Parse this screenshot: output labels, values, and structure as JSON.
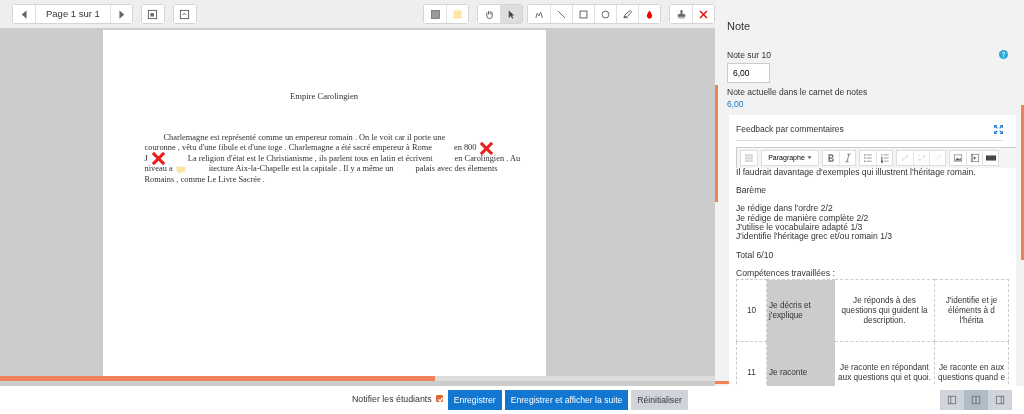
{
  "viewer_toolbar": {
    "page_label": "Page 1 sur 1",
    "nav": [
      {
        "kind": "prev"
      },
      {
        "kind": "label"
      },
      {
        "kind": "next"
      }
    ],
    "view_tools": [
      {
        "kind": "search-comments"
      },
      {
        "kind": "expand"
      }
    ],
    "tool_groups": [
      [
        {
          "kind": "color-gray",
          "selected": false
        },
        {
          "kind": "color-yellow",
          "selected": false
        }
      ],
      [
        {
          "kind": "hand",
          "selected": false
        },
        {
          "kind": "pointer",
          "selected": true
        }
      ],
      [
        {
          "kind": "pen",
          "selected": false
        },
        {
          "kind": "line",
          "selected": false
        },
        {
          "kind": "rectangle",
          "selected": false
        },
        {
          "kind": "oval",
          "selected": false
        },
        {
          "kind": "highlighter",
          "selected": false
        },
        {
          "kind": "drop",
          "selected": false
        }
      ],
      [
        {
          "kind": "stamp",
          "selected": false
        },
        {
          "kind": "cross",
          "selected": false
        }
      ]
    ]
  },
  "document": {
    "title": "Empire Carolingien",
    "lines": [
      {
        "indent": true,
        "segments": [
          {
            "text": "Charlemagne est représenté comme un empereur romain . On le voit car il porte une"
          }
        ]
      },
      {
        "indent": false,
        "segments": [
          {
            "text": "couronne , vêtu d'une fibule et d'une toge . Charlemagne a été sacré empereur à Rome"
          },
          {
            "text": "en 800"
          },
          {
            "kind": "cross"
          }
        ]
      },
      {
        "indent": false,
        "segments": [
          {
            "text": "J"
          },
          {
            "kind": "cross"
          },
          {
            "text": "La religion d'état est le Christianisme , ils parlent tous en latin et écrivent"
          },
          {
            "text": "en Carolingien . Au"
          }
        ]
      },
      {
        "indent": false,
        "segments": [
          {
            "text": "niveau a"
          },
          {
            "kind": "comment"
          },
          {
            "text": "itecture Aix-la-Chapelle est la capitale . Il y a même un"
          },
          {
            "text": "palais avec des élements"
          }
        ]
      },
      {
        "indent": false,
        "segments": [
          {
            "text": "Romains , comme Le Livre Sacrée ."
          }
        ]
      }
    ]
  },
  "grade": {
    "heading": "Note",
    "label": "Note sur 10",
    "value": "6,00",
    "current_label": "Note actuelle dans le carnet de notes",
    "current_value": "6,00"
  },
  "feedback": {
    "title": "Feedback par commentaires",
    "editor_toolbar": [
      [
        {
          "kind": "toggle"
        }
      ],
      [
        {
          "kind": "format",
          "text": "Paragraphe"
        }
      ],
      [
        {
          "kind": "bold"
        },
        {
          "kind": "italic"
        }
      ],
      [
        {
          "kind": "bullets"
        },
        {
          "kind": "numbers"
        }
      ],
      [
        {
          "kind": "link"
        },
        {
          "kind": "unlink"
        },
        {
          "kind": "link-disabled"
        }
      ],
      [
        {
          "kind": "image"
        },
        {
          "kind": "media"
        },
        {
          "kind": "keyboard"
        }
      ]
    ],
    "paragraphs": [
      [
        "Il faudrait davantage d'exemples qui illustrent l'héritage romain."
      ],
      [
        "Barème"
      ],
      [
        "Je rédige dans l'ordre 2/2",
        "Je rédige de manière complète 2/2",
        "J'utilise le vocabulaire adapté 1/3",
        "J'identifie l'héritage grec et/ou romain 1/3"
      ],
      [
        "Total 6/10"
      ],
      [
        "Compétences travaillées :"
      ]
    ],
    "table": {
      "rows": [
        [
          "10",
          "Je décris et j'explique",
          "Je réponds à des questions qui guident la description.",
          "J'identifie et je éléments à d l'hérita"
        ],
        [
          "11",
          "Je raconte",
          "Je raconte en répondant aux questions qui et quoi.",
          "Je raconte en aux questions quand e"
        ]
      ]
    }
  },
  "footer": {
    "notify": {
      "label": "Notifier les étudiants",
      "checked": true
    },
    "buttons": [
      {
        "text": "Enregistrer",
        "kind": "primary"
      },
      {
        "text": "Enregistrer et afficher la suite",
        "kind": "primary"
      },
      {
        "text": "Réinitialiser",
        "kind": "secondary"
      }
    ],
    "layouts": [
      {
        "kind": "left",
        "selected": false
      },
      {
        "kind": "both",
        "selected": true
      },
      {
        "kind": "right",
        "selected": false
      }
    ]
  }
}
